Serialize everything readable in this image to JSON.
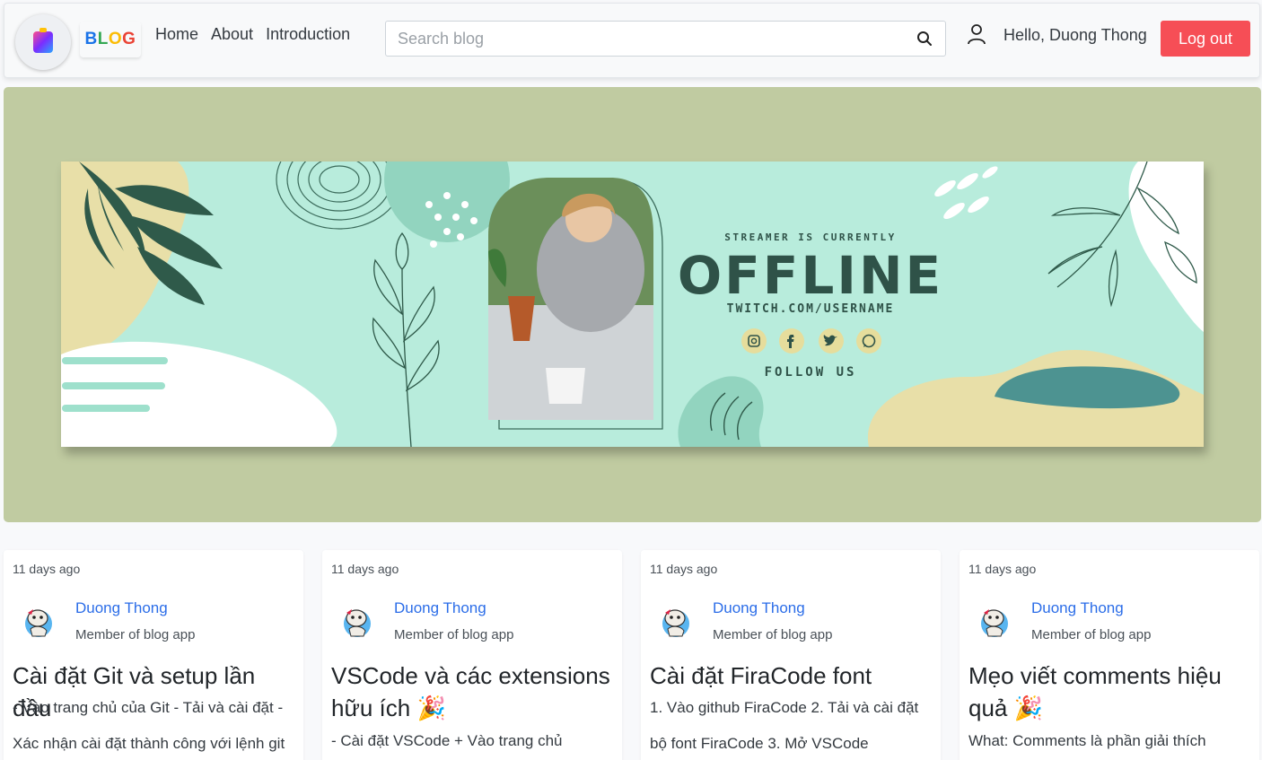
{
  "nav": {
    "brand": [
      "B",
      "L",
      "O",
      "G"
    ],
    "links": [
      "Home",
      "About",
      "Introduction"
    ],
    "search_placeholder": "Search blog",
    "greeting": "Hello, Duong Thong",
    "logout_label": "Log out"
  },
  "banner": {
    "status_line": "STREAMER IS CURRENTLY",
    "headline": "OFFLINE",
    "url": "TWITCH.COM/USERNAME",
    "follow": "FOLLOW US",
    "social_icons": [
      "instagram-icon",
      "facebook-icon",
      "twitter-icon",
      "whatsapp-icon"
    ]
  },
  "posts": [
    {
      "time": "11 days ago",
      "author": "Duong Thong",
      "role": "Member of blog app",
      "title": "Cài đặt Git và setup lần đầu",
      "excerpt": "- Vào trang chủ của Git - Tải và cài đặt - Xác nhận cài đặt thành công với lệnh git"
    },
    {
      "time": "11 days ago",
      "author": "Duong Thong",
      "role": "Member of blog app",
      "title": "VSCode và các extensions hữu ích 🎉",
      "excerpt": "- Cài đặt VSCode + Vào trang chủ"
    },
    {
      "time": "11 days ago",
      "author": "Duong Thong",
      "role": "Member of blog app",
      "title": "Cài đặt FiraCode font",
      "excerpt": "1. Vào github FiraCode 2. Tải và cài đặt bộ font FiraCode 3. Mở VSCode"
    },
    {
      "time": "11 days ago",
      "author": "Duong Thong",
      "role": "Member of blog app",
      "title": "Mẹo viết comments hiệu quả 🎉",
      "excerpt": "What: Comments là phần giải thích"
    }
  ],
  "colors": {
    "logout_bg": "#f64e56",
    "hero_bg": "#c0cba1",
    "banner_bg": "#b8ecdc",
    "banner_text": "#2f5248",
    "author_link": "#2b6de8"
  }
}
